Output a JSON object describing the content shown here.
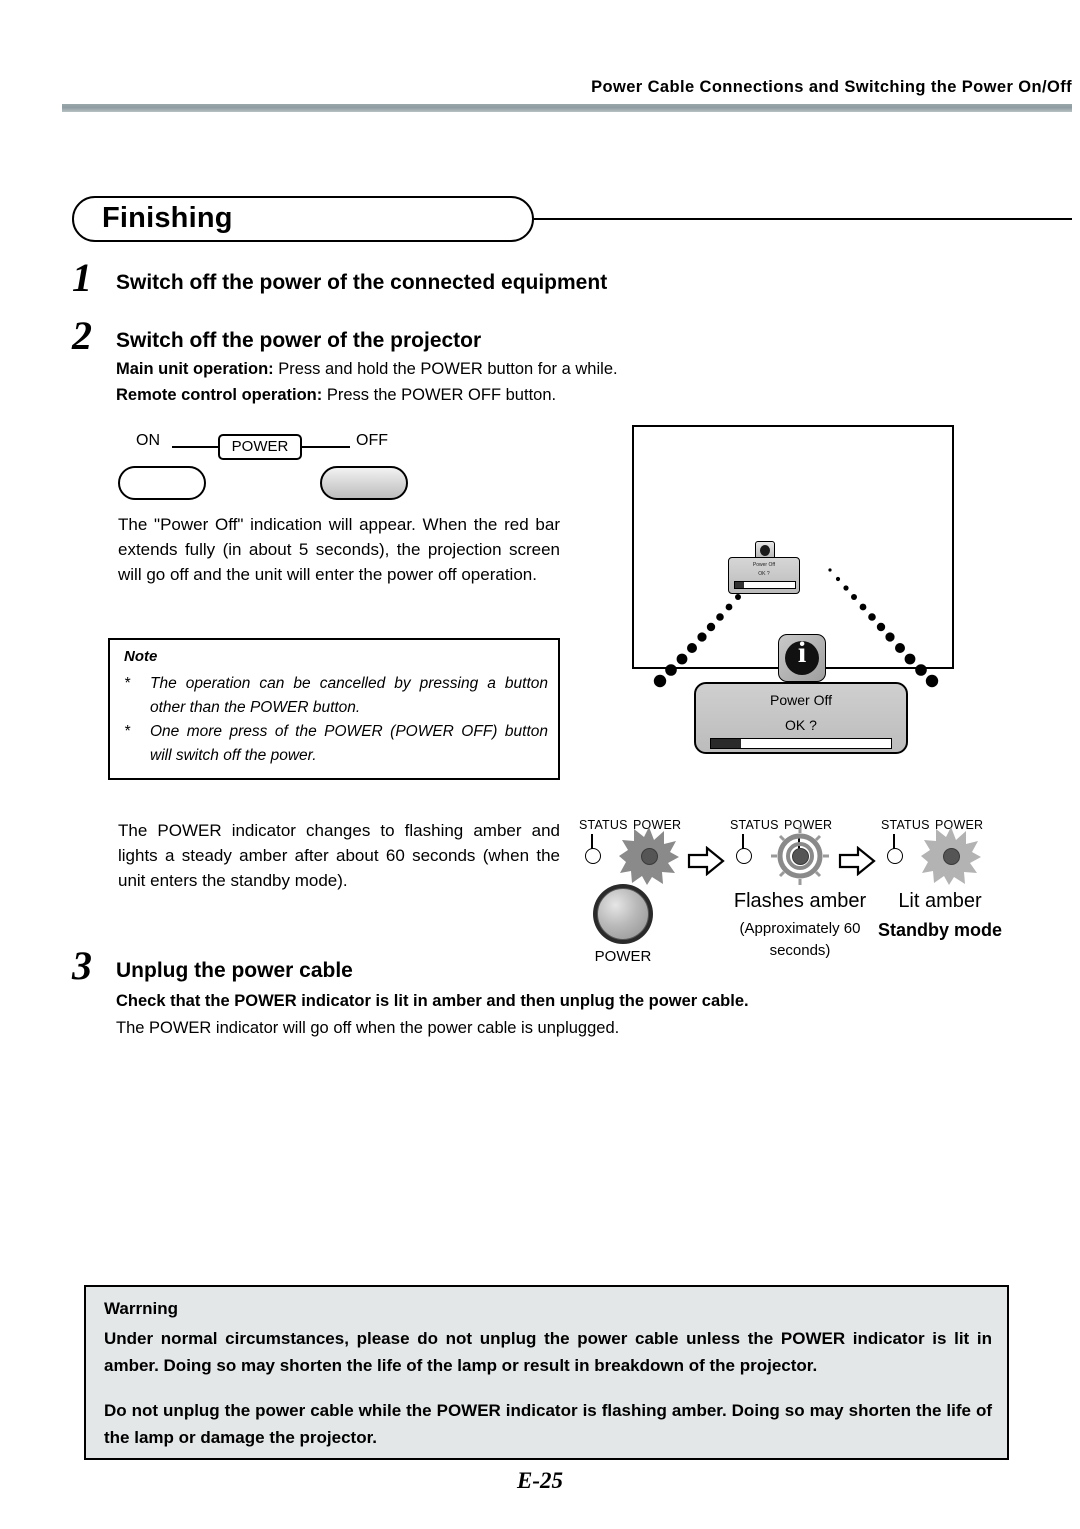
{
  "header": {
    "title": "Power Cable Connections and Switching the Power On/Off"
  },
  "section": {
    "banner": "Finishing"
  },
  "steps": [
    {
      "number": "1",
      "heading": "Switch off the power of the connected equipment"
    },
    {
      "number": "2",
      "heading": "Switch off the power of the projector",
      "sub": [
        {
          "bold": "Main unit operation:",
          "rest": " Press and hold the POWER button for a while."
        },
        {
          "bold": "Remote control operation:",
          "rest": " Press the POWER OFF button."
        }
      ]
    },
    {
      "number": "3",
      "heading": "Unplug the power cable",
      "bold_line": "Check that the POWER indicator is lit in amber and then unplug the power cable.",
      "plain_line": "The POWER indicator will go off when the power cable is unplugged."
    }
  ],
  "switch_diagram": {
    "on_label": "ON",
    "power_label": "POWER",
    "off_label": "OFF"
  },
  "body_paragraph_1": "The \"Power Off\" indication will appear. When the red bar extends fully (in about 5 seconds), the projection screen will go off and the unit will enter the power off operation.",
  "note": {
    "title": "Note",
    "star": "*",
    "items": [
      "The operation can be cancelled by pressing a button other than the POWER button.",
      "One more press of the POWER (POWER OFF) button will switch off the power."
    ]
  },
  "projector_illustration": {
    "mini_screen_line1": "Power Off",
    "mini_screen_line2": "OK ?",
    "info_icon_glyph": "i",
    "dialog": {
      "line1": "Power Off",
      "line2": "OK ?"
    }
  },
  "body_paragraph_2": "The POWER indicator changes to flashing amber and lights a steady amber after about 60 seconds (when the unit enters the standby mode).",
  "indicator_sequence": {
    "status_label": "STATUS",
    "power_label": "POWER",
    "power_button_label": "POWER",
    "stage2_title": "Flashes amber",
    "stage2_sub": "(Approximately 60 seconds)",
    "stage3_title": "Lit amber",
    "stage3_sub": "Standby mode"
  },
  "warning": {
    "title": "Warrning",
    "paragraph1": "Under normal circumstances, please do not unplug the power cable unless the POWER indicator is lit in amber. Doing so may shorten the life of the lamp or result in breakdown of the projector.",
    "paragraph2": "Do not unplug the power cable while the POWER indicator is flashing amber. Doing so may shorten the life of the lamp or damage the projector."
  },
  "footer": {
    "page": "E-25"
  },
  "colors": {
    "rule": "#8e9ca1",
    "warning_bg": "#e3e7e8",
    "indicator_gray": "#8a8a8a"
  }
}
